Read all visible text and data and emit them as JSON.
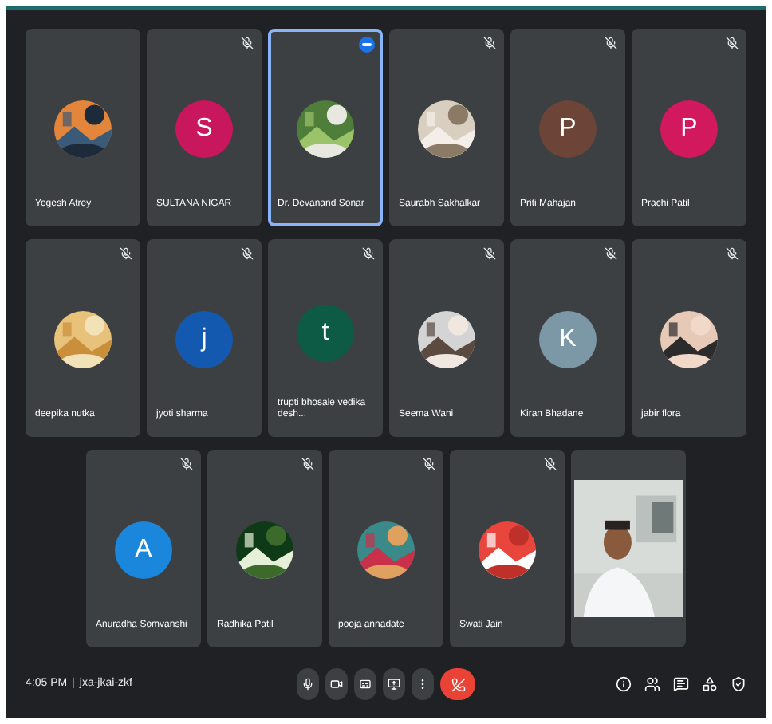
{
  "tiles": [
    {
      "name": "Yogesh Atrey",
      "kind": "picture",
      "muted": false,
      "selected": false,
      "speaking": false
    },
    {
      "name": "SULTANA NIGAR",
      "kind": "letter",
      "letter": "S",
      "color": "#c8175d",
      "muted": true,
      "selected": false,
      "speaking": false
    },
    {
      "name": "Dr. Devanand Sonar",
      "kind": "picture",
      "muted": false,
      "selected": true,
      "speaking": true
    },
    {
      "name": "Saurabh Sakhalkar",
      "kind": "picture",
      "muted": true,
      "selected": false,
      "speaking": false
    },
    {
      "name": "Priti Mahajan",
      "kind": "letter",
      "letter": "P",
      "color": "#6d4438",
      "muted": true,
      "selected": false,
      "speaking": false
    },
    {
      "name": "Prachi Patil",
      "kind": "letter",
      "letter": "P",
      "color": "#d3195e",
      "muted": true,
      "selected": false,
      "speaking": false
    },
    {
      "name": "deepika nutka",
      "kind": "picture",
      "muted": true,
      "selected": false,
      "speaking": false
    },
    {
      "name": "jyoti sharma",
      "kind": "letter",
      "letter": "j",
      "color": "#1459b0",
      "muted": true,
      "selected": false,
      "speaking": false
    },
    {
      "name": "trupti bhosale vedika desh...",
      "kind": "letter",
      "letter": "t",
      "color": "#0d5a45",
      "muted": true,
      "selected": false,
      "speaking": false
    },
    {
      "name": "Seema Wani",
      "kind": "picture",
      "muted": true,
      "selected": false,
      "speaking": false
    },
    {
      "name": "Kiran Bhadane",
      "kind": "letter",
      "letter": "K",
      "color": "#7c97a6",
      "muted": true,
      "selected": false,
      "speaking": false
    },
    {
      "name": "jabir flora",
      "kind": "picture",
      "muted": true,
      "selected": false,
      "speaking": false
    },
    {
      "name": "Anuradha Somvanshi",
      "kind": "letter",
      "letter": "A",
      "color": "#1a86dc",
      "muted": true,
      "selected": false,
      "speaking": false
    },
    {
      "name": "Radhika Patil",
      "kind": "picture",
      "muted": true,
      "selected": false,
      "speaking": false
    },
    {
      "name": "pooja annadate",
      "kind": "picture",
      "muted": true,
      "selected": false,
      "speaking": false
    },
    {
      "name": "Swati Jain",
      "kind": "picture",
      "muted": true,
      "selected": false,
      "speaking": false
    },
    {
      "kind": "video",
      "muted": false,
      "selected": false,
      "speaking": false
    }
  ],
  "footer": {
    "time": "4:05 PM",
    "separator": "|",
    "meeting_code": "jxa-jkai-zkf"
  }
}
